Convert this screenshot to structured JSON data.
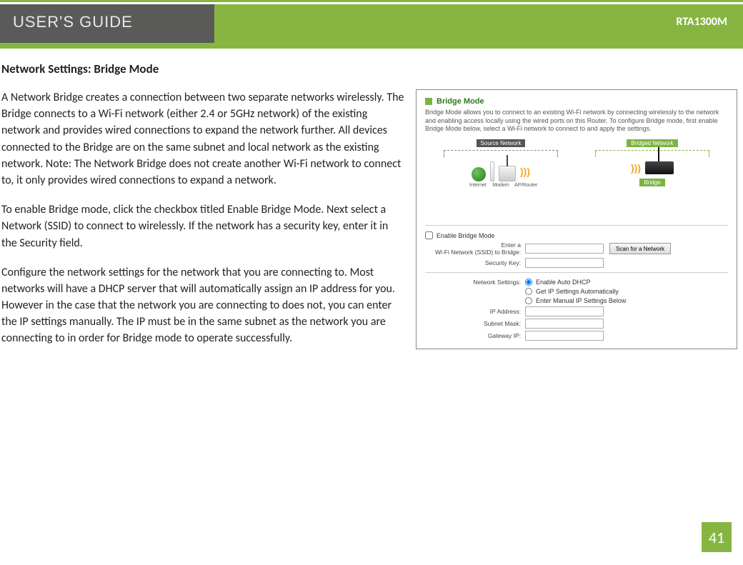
{
  "header": {
    "guide_label": "USER'S GUIDE",
    "model": "RTA1300M"
  },
  "page": {
    "title": "Network Settings: Bridge Mode",
    "paragraphs": [
      "A Network Bridge creates a connection between two separate networks wirelessly. The Bridge connects to a Wi-Fi network (either 2.4 or 5GHz network) of the existing network and provides wired connections to expand the network further. All devices connected to the Bridge are on the same subnet and local network as the existing network. Note: The Network Bridge does not create another Wi-Fi network to connect to, it only provides wired connections to expand a network.",
      "To enable Bridge mode, click the checkbox titled Enable Bridge Mode. Next select a Network (SSID) to connect to wirelessly. If the network has a security key, enter it in the Security field.",
      "Configure the network settings for the network that you are connecting to. Most networks will have a DHCP server that will automatically assign an IP address for you. However in the case that the network you are connecting to does not, you can enter the IP settings manually. The IP must be in the same subnet as the network you are connecting to in order for Bridge mode to operate successfully."
    ],
    "number": "41"
  },
  "screenshot": {
    "title": "Bridge Mode",
    "description": "Bridge Mode allows you to connect to an existing Wi-Fi network by connecting wirelessly to the network and enabling access locally using the wired ports on this Router. To configure Bridge mode, first enable Bridge Mode below, select a Wi-Fi network to connect to and apply the settings.",
    "diagram": {
      "source_label": "Source Network",
      "bridged_label": "Bridged Network",
      "internet": "Internet",
      "modem": "Modem",
      "aprouter": "AP/Router",
      "bridge": "Bridge"
    },
    "enable_label": "Enable Bridge Mode",
    "ssid_label": "Enter a\nWi-Fi Network (SSID) to Bridge:",
    "security_key_label": "Security Key:",
    "scan_button": "Scan for a Network",
    "network_settings_label": "Network Settings:",
    "radios": {
      "auto_dhcp": "Enable Auto DHCP",
      "get_auto": "Get IP Settings Automatically",
      "manual": "Enter Manual IP Settings Below"
    },
    "ip_address_label": "IP Address:",
    "subnet_mask_label": "Subnet Mask:",
    "gateway_ip_label": "Gateway IP:"
  }
}
